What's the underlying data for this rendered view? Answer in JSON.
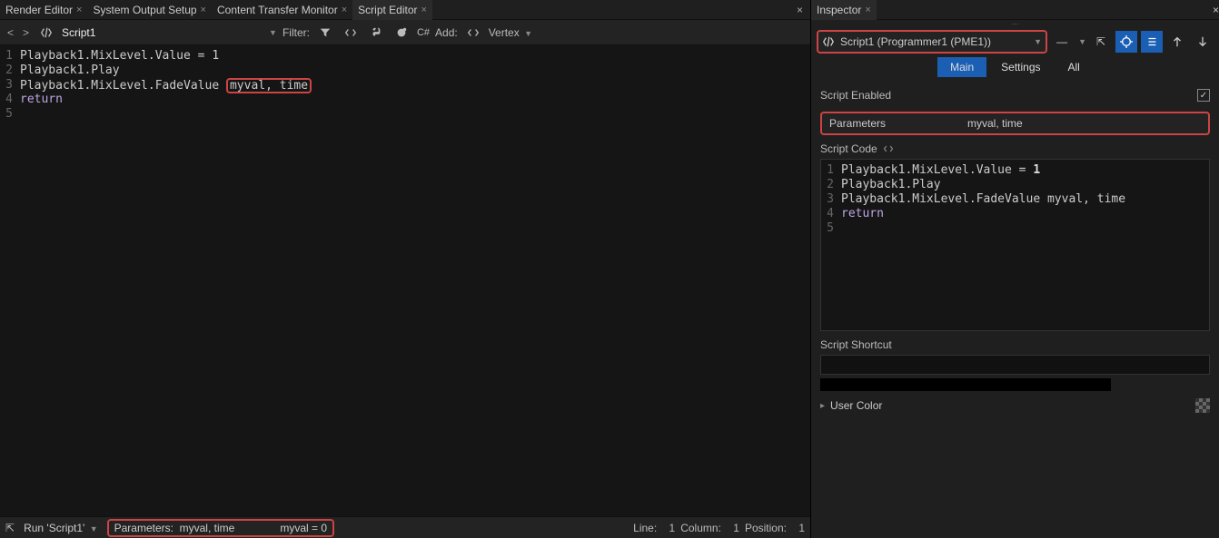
{
  "left": {
    "tabs": [
      {
        "label": "Render Editor"
      },
      {
        "label": "System Output Setup"
      },
      {
        "label": "Content Transfer Monitor"
      },
      {
        "label": "Script Editor"
      }
    ],
    "toolbar": {
      "crumb": "Script1",
      "filter_label": "Filter:",
      "csharp": "C#",
      "add_label": "Add:",
      "add_value": "Vertex"
    },
    "code": {
      "lines": [
        "Playback1.MixLevel.Value = 1",
        "Playback1.Play",
        "Playback1.MixLevel.FadeValue",
        "return",
        ""
      ],
      "line3_box": "myval, time"
    },
    "status": {
      "run_label": "Run 'Script1'",
      "params_label": "Parameters:",
      "params_value": "myval, time",
      "assign": "myval = 0",
      "line_lbl": "Line:",
      "line_val": "1",
      "col_lbl": "Column:",
      "col_val": "1",
      "pos_lbl": "Position:",
      "pos_val": "1"
    }
  },
  "right": {
    "tab": "Inspector",
    "object": "Script1 (Programmer1 (PME1))",
    "tabs2": {
      "main": "Main",
      "settings": "Settings",
      "all": "All"
    },
    "enabled_label": "Script Enabled",
    "params_label": "Parameters",
    "params_value": "myval, time",
    "code_label": "Script Code",
    "code": {
      "lines": [
        "Playback1.MixLevel.Value = 1",
        "Playback1.Play",
        "Playback1.MixLevel.FadeValue myval, time",
        "return",
        ""
      ]
    },
    "shortcut_label": "Script Shortcut",
    "usercolor_label": "User Color"
  }
}
